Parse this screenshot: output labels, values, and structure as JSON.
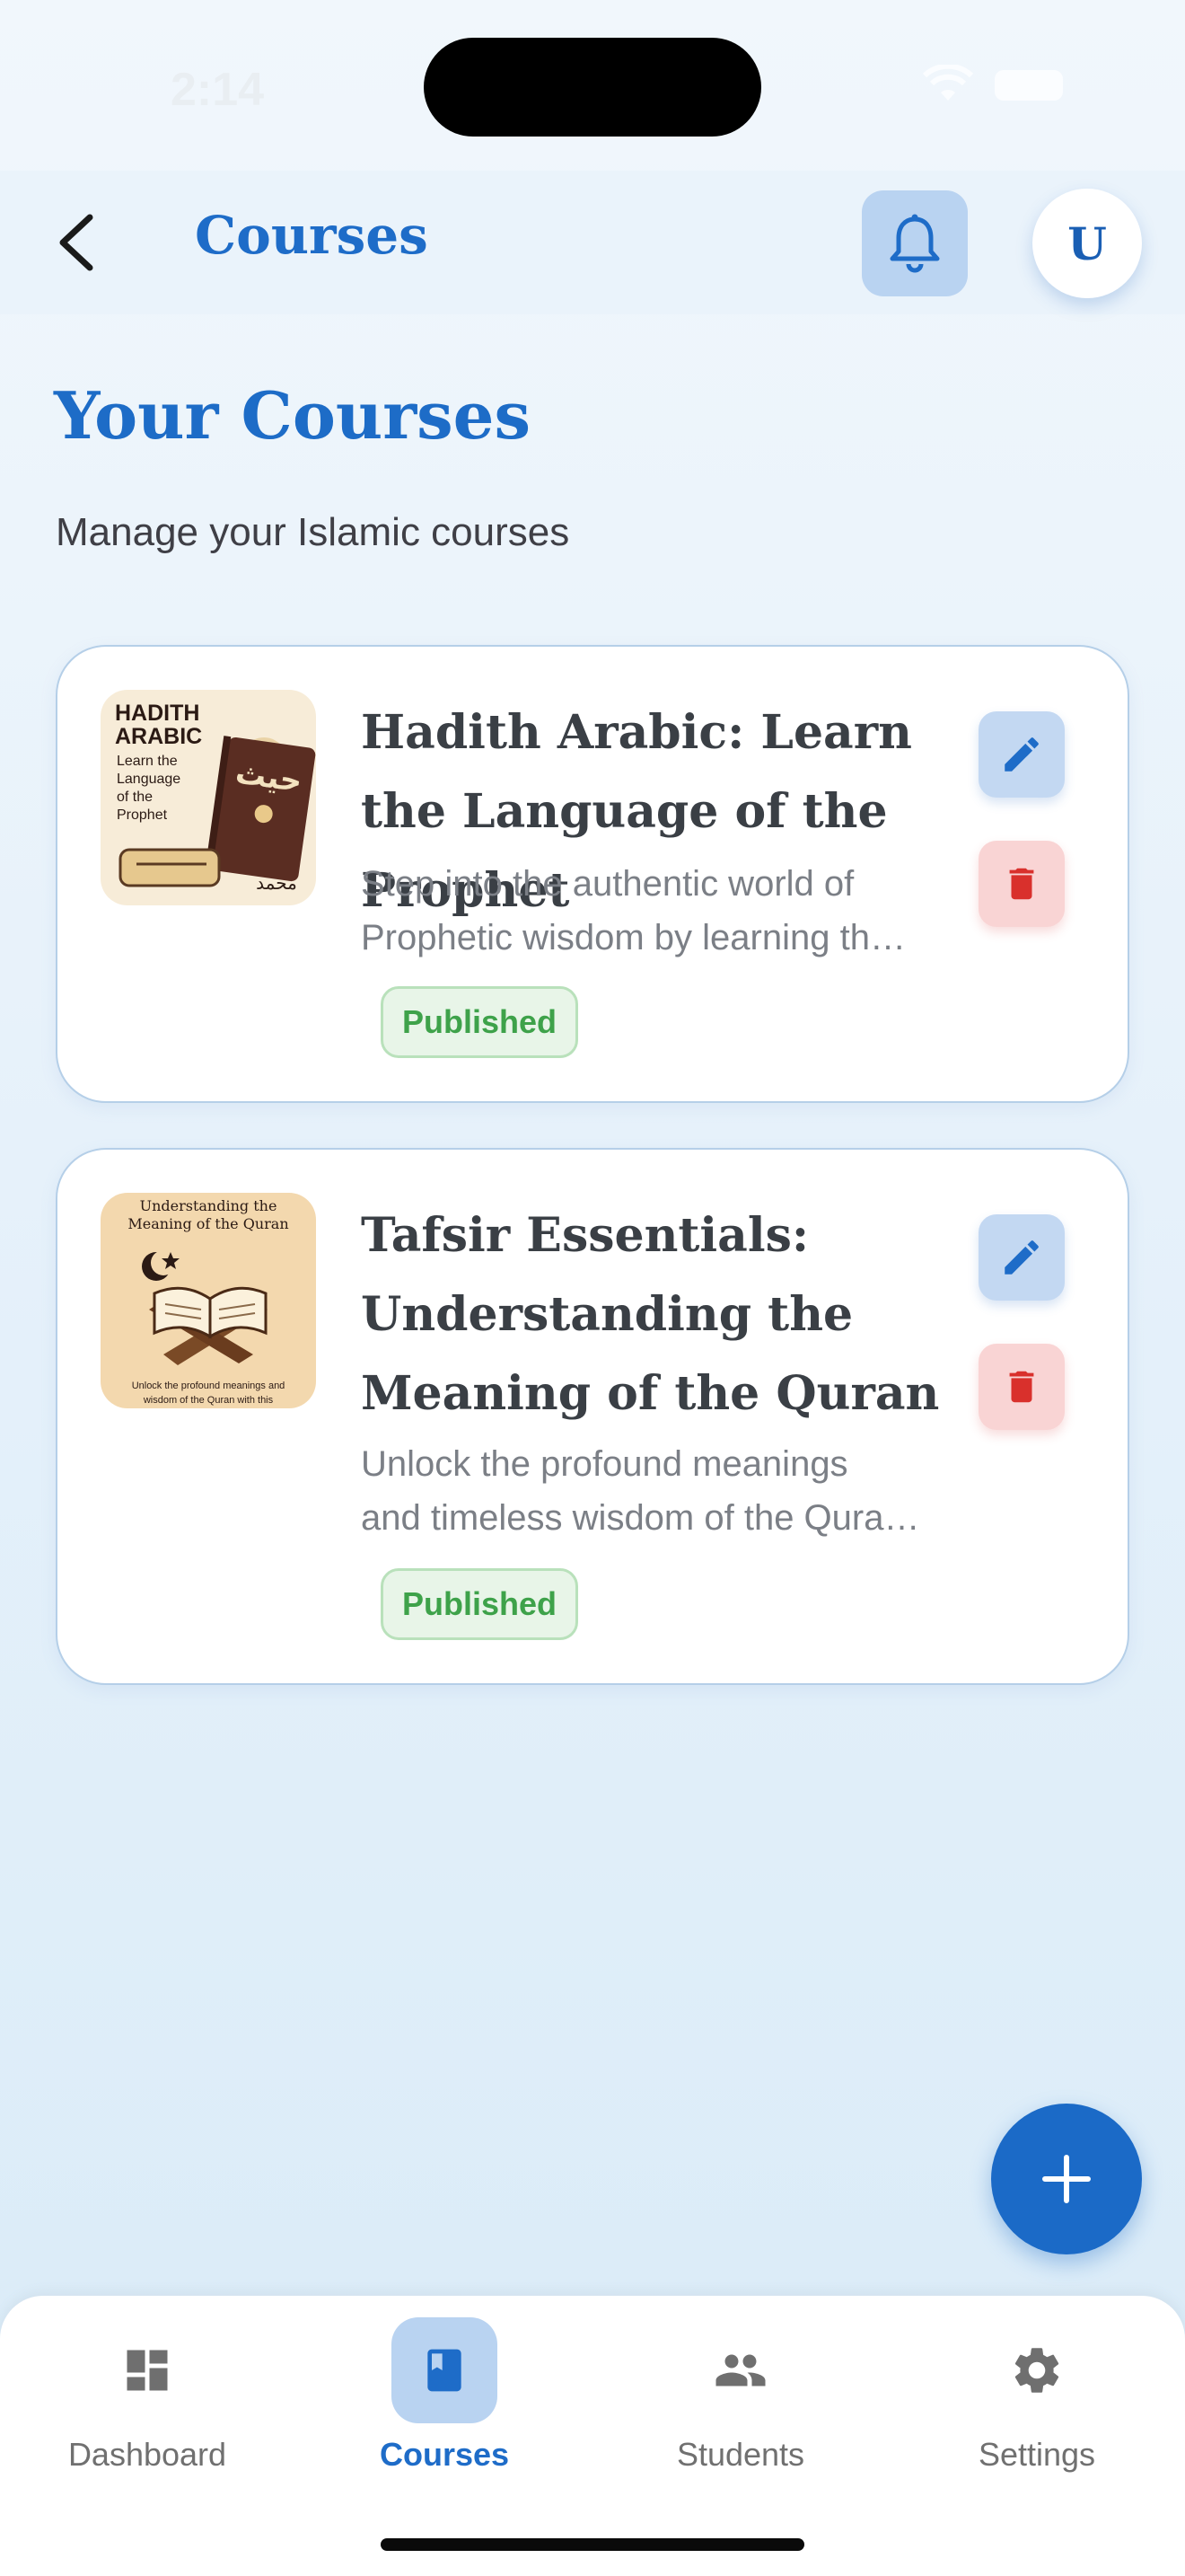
{
  "status_bar": {
    "time": "2:14"
  },
  "header": {
    "title": "Courses",
    "avatar_initial": "U"
  },
  "page": {
    "title": "Your Courses",
    "subtitle": "Manage your Islamic courses"
  },
  "courses": [
    {
      "title": "Hadith Arabic: Learn the Language of the Prophet",
      "description_line1": "Step into the authentic world of",
      "description_line2": "Prophetic wisdom by learning th…",
      "status": "Published",
      "thumbnail": {
        "heading1": "HADITH",
        "heading2": "ARABIC",
        "sub1": "Learn the",
        "sub2": "Language",
        "sub3": "of the",
        "sub4": "Prophet",
        "book_arabic": "حيث",
        "calligraphy": "محمد"
      }
    },
    {
      "title": "Tafsir Essentials: Understanding the Meaning of the Quran",
      "description_line1": "Unlock the profound meanings",
      "description_line2": "and timeless wisdom of the Qura…",
      "status": "Published",
      "thumbnail": {
        "heading1": "Understanding the",
        "heading2": "Meaning of the Quran",
        "footer1": "Unlock the profound meanings and",
        "footer2": "wisdom of the Quran with this"
      }
    }
  ],
  "nav": [
    {
      "label": "Dashboard",
      "icon": "dashboard-icon",
      "active": false
    },
    {
      "label": "Courses",
      "icon": "book-icon",
      "active": true
    },
    {
      "label": "Students",
      "icon": "people-icon",
      "active": false
    },
    {
      "label": "Settings",
      "icon": "gear-icon",
      "active": false
    }
  ],
  "colors": {
    "primary": "#1e6cc8",
    "published": "#3ea24a",
    "delete": "#d9302c"
  }
}
